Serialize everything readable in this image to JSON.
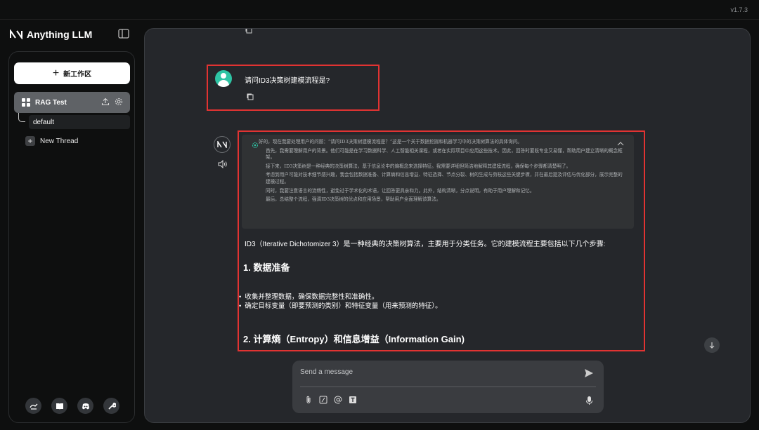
{
  "app": {
    "name": "Anything LLM",
    "version": "v1.7.3"
  },
  "sidebar": {
    "new_workspace_label": "新工作区",
    "workspace": {
      "name": "RAG Test"
    },
    "threads": [
      {
        "label": "default"
      },
      {
        "label": "New Thread"
      }
    ],
    "footer_icons": [
      "community-icon",
      "docs-icon",
      "discord-icon",
      "settings-wrench-icon"
    ]
  },
  "chat": {
    "user_message": "请问ID3决策树建模流程是?",
    "thought": [
      "好的，现在我要处理用户的问题：“请问ID3决策树建模流程是？”这是一个关于数据挖掘和机器学习中的决策树算法的具体询问。",
      "首先，我需要理解用户的背景。他们可能是在学习数据科学、人工智能相关课程，或者在实际项目中应用这些技术。因此，回答时要既专业又易懂，帮助用户建立清晰的概念框架。",
      "接下来，ID3决策树是一种经典的决策树算法，基于信息论中的熵概念来选择特征。我需要详细但简洁地解释其建模流程，确保每个步骤都清楚明了。",
      "考虑到用户可能对技术细节感兴趣，我会包括数据准备、计算熵和信息增益、特征选择、节点分裂、树的生成与剪枝这些关键步骤，并在最后提及评估与优化部分，展示完整的建模过程。",
      "同时，我要注意语言的流畅性，避免过于学术化的术语，让回答更具亲和力。此外，结构清晰，分点说明，有助于用户理解和记忆。",
      "最后，总结整个流程，强调ID3决策树的优点和应用场景，帮助用户全面理解该算法。"
    ],
    "answer_intro": "ID3（Iterative Dichotomizer 3）是一种经典的决策树算法，主要用于分类任务。它的建模流程主要包括以下几个步骤:",
    "section1_title": "1. 数据准备",
    "section1_bullets": [
      "收集并整理数据，确保数据完整性和准确性。",
      "确定目标变量（即要预测的类别）和特征变量（用来预测的特征）。"
    ],
    "section2_title": "2. 计算熵（Entropy）和信息增益（Information Gain)"
  },
  "composer": {
    "placeholder": "Send a message",
    "tools": [
      "attach-icon",
      "slash-command-icon",
      "at-mention-icon",
      "text-size-icon"
    ]
  },
  "colors": {
    "highlight": "#e13332",
    "avatar": "#2ec4a4",
    "panel": "#25272b"
  }
}
